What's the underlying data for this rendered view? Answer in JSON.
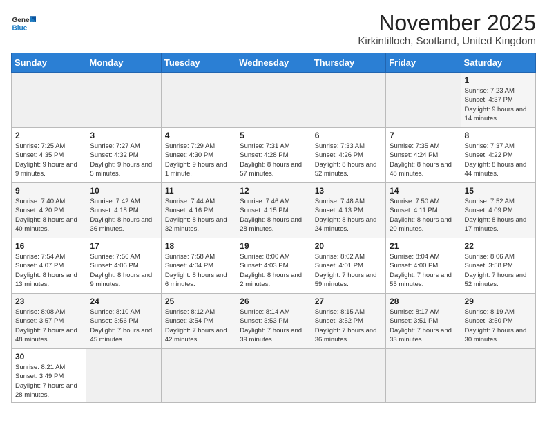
{
  "header": {
    "logo_general": "General",
    "logo_blue": "Blue",
    "title": "November 2025",
    "subtitle": "Kirkintilloch, Scotland, United Kingdom"
  },
  "weekdays": [
    "Sunday",
    "Monday",
    "Tuesday",
    "Wednesday",
    "Thursday",
    "Friday",
    "Saturday"
  ],
  "weeks": [
    [
      {
        "day": "",
        "info": ""
      },
      {
        "day": "",
        "info": ""
      },
      {
        "day": "",
        "info": ""
      },
      {
        "day": "",
        "info": ""
      },
      {
        "day": "",
        "info": ""
      },
      {
        "day": "",
        "info": ""
      },
      {
        "day": "1",
        "info": "Sunrise: 7:23 AM\nSunset: 4:37 PM\nDaylight: 9 hours\nand 14 minutes."
      }
    ],
    [
      {
        "day": "2",
        "info": "Sunrise: 7:25 AM\nSunset: 4:35 PM\nDaylight: 9 hours\nand 9 minutes."
      },
      {
        "day": "3",
        "info": "Sunrise: 7:27 AM\nSunset: 4:32 PM\nDaylight: 9 hours\nand 5 minutes."
      },
      {
        "day": "4",
        "info": "Sunrise: 7:29 AM\nSunset: 4:30 PM\nDaylight: 9 hours\nand 1 minute."
      },
      {
        "day": "5",
        "info": "Sunrise: 7:31 AM\nSunset: 4:28 PM\nDaylight: 8 hours\nand 57 minutes."
      },
      {
        "day": "6",
        "info": "Sunrise: 7:33 AM\nSunset: 4:26 PM\nDaylight: 8 hours\nand 52 minutes."
      },
      {
        "day": "7",
        "info": "Sunrise: 7:35 AM\nSunset: 4:24 PM\nDaylight: 8 hours\nand 48 minutes."
      },
      {
        "day": "8",
        "info": "Sunrise: 7:37 AM\nSunset: 4:22 PM\nDaylight: 8 hours\nand 44 minutes."
      }
    ],
    [
      {
        "day": "9",
        "info": "Sunrise: 7:40 AM\nSunset: 4:20 PM\nDaylight: 8 hours\nand 40 minutes."
      },
      {
        "day": "10",
        "info": "Sunrise: 7:42 AM\nSunset: 4:18 PM\nDaylight: 8 hours\nand 36 minutes."
      },
      {
        "day": "11",
        "info": "Sunrise: 7:44 AM\nSunset: 4:16 PM\nDaylight: 8 hours\nand 32 minutes."
      },
      {
        "day": "12",
        "info": "Sunrise: 7:46 AM\nSunset: 4:15 PM\nDaylight: 8 hours\nand 28 minutes."
      },
      {
        "day": "13",
        "info": "Sunrise: 7:48 AM\nSunset: 4:13 PM\nDaylight: 8 hours\nand 24 minutes."
      },
      {
        "day": "14",
        "info": "Sunrise: 7:50 AM\nSunset: 4:11 PM\nDaylight: 8 hours\nand 20 minutes."
      },
      {
        "day": "15",
        "info": "Sunrise: 7:52 AM\nSunset: 4:09 PM\nDaylight: 8 hours\nand 17 minutes."
      }
    ],
    [
      {
        "day": "16",
        "info": "Sunrise: 7:54 AM\nSunset: 4:07 PM\nDaylight: 8 hours\nand 13 minutes."
      },
      {
        "day": "17",
        "info": "Sunrise: 7:56 AM\nSunset: 4:06 PM\nDaylight: 8 hours\nand 9 minutes."
      },
      {
        "day": "18",
        "info": "Sunrise: 7:58 AM\nSunset: 4:04 PM\nDaylight: 8 hours\nand 6 minutes."
      },
      {
        "day": "19",
        "info": "Sunrise: 8:00 AM\nSunset: 4:03 PM\nDaylight: 8 hours\nand 2 minutes."
      },
      {
        "day": "20",
        "info": "Sunrise: 8:02 AM\nSunset: 4:01 PM\nDaylight: 7 hours\nand 59 minutes."
      },
      {
        "day": "21",
        "info": "Sunrise: 8:04 AM\nSunset: 4:00 PM\nDaylight: 7 hours\nand 55 minutes."
      },
      {
        "day": "22",
        "info": "Sunrise: 8:06 AM\nSunset: 3:58 PM\nDaylight: 7 hours\nand 52 minutes."
      }
    ],
    [
      {
        "day": "23",
        "info": "Sunrise: 8:08 AM\nSunset: 3:57 PM\nDaylight: 7 hours\nand 48 minutes."
      },
      {
        "day": "24",
        "info": "Sunrise: 8:10 AM\nSunset: 3:56 PM\nDaylight: 7 hours\nand 45 minutes."
      },
      {
        "day": "25",
        "info": "Sunrise: 8:12 AM\nSunset: 3:54 PM\nDaylight: 7 hours\nand 42 minutes."
      },
      {
        "day": "26",
        "info": "Sunrise: 8:14 AM\nSunset: 3:53 PM\nDaylight: 7 hours\nand 39 minutes."
      },
      {
        "day": "27",
        "info": "Sunrise: 8:15 AM\nSunset: 3:52 PM\nDaylight: 7 hours\nand 36 minutes."
      },
      {
        "day": "28",
        "info": "Sunrise: 8:17 AM\nSunset: 3:51 PM\nDaylight: 7 hours\nand 33 minutes."
      },
      {
        "day": "29",
        "info": "Sunrise: 8:19 AM\nSunset: 3:50 PM\nDaylight: 7 hours\nand 30 minutes."
      }
    ],
    [
      {
        "day": "30",
        "info": "Sunrise: 8:21 AM\nSunset: 3:49 PM\nDaylight: 7 hours\nand 28 minutes."
      },
      {
        "day": "",
        "info": ""
      },
      {
        "day": "",
        "info": ""
      },
      {
        "day": "",
        "info": ""
      },
      {
        "day": "",
        "info": ""
      },
      {
        "day": "",
        "info": ""
      },
      {
        "day": "",
        "info": ""
      }
    ]
  ]
}
